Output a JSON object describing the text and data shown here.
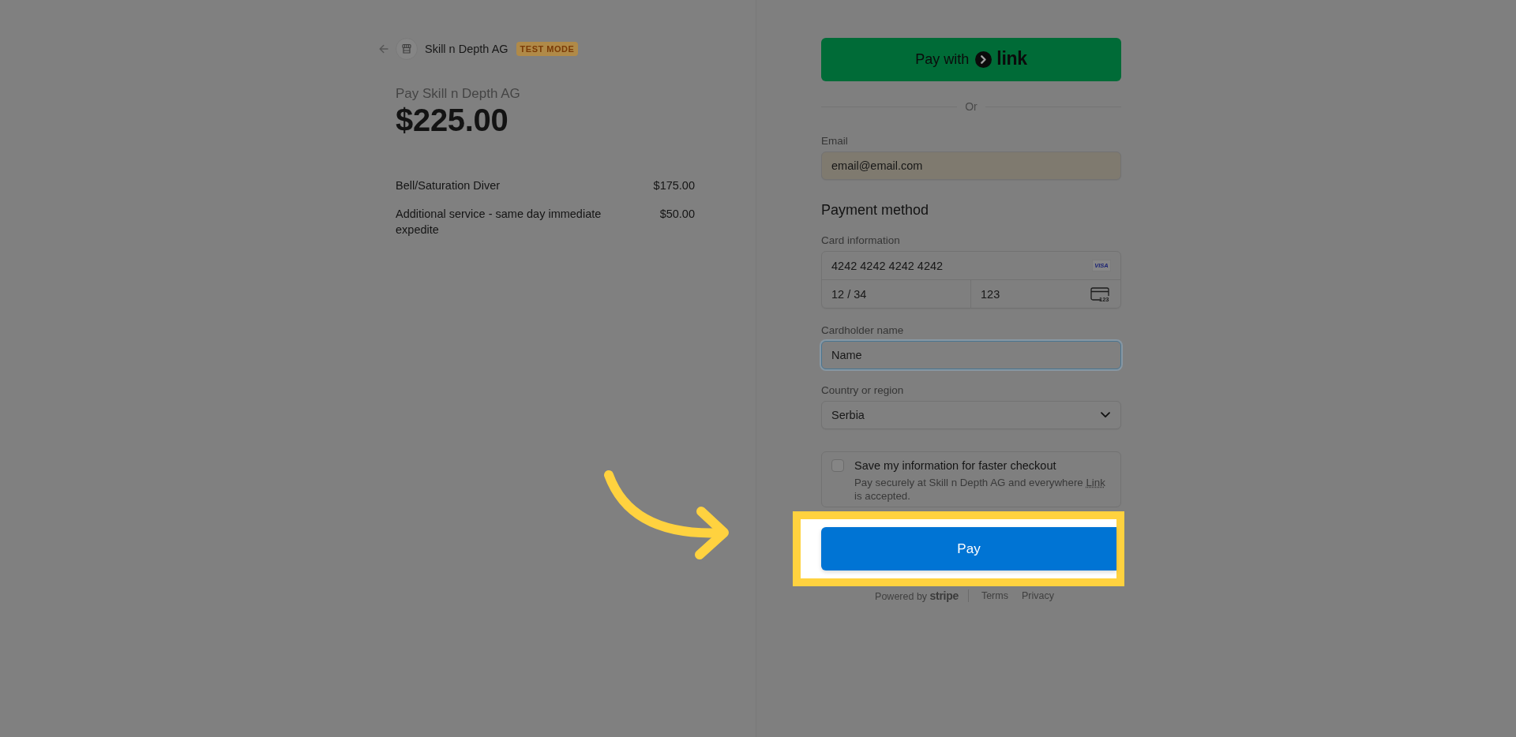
{
  "header": {
    "business_name": "Skill n Depth AG",
    "badge": "TEST MODE"
  },
  "summary": {
    "title": "Pay Skill n Depth AG",
    "amount": "$225.00"
  },
  "line_items": [
    {
      "name": "Bell/Saturation Diver",
      "price": "$175.00"
    },
    {
      "name": "Additional service - same day immediate expedite",
      "price": "$50.00"
    }
  ],
  "link_button": {
    "label": "Pay with",
    "brand": "link"
  },
  "separator": {
    "label": "Or"
  },
  "email": {
    "label": "Email",
    "value": "email@email.com",
    "autofilled": true
  },
  "payment_method": {
    "title": "Payment method",
    "card": {
      "label": "Card information",
      "number": "4242 4242 4242 4242",
      "brand_logo": "VISA",
      "expiry": "12 / 34",
      "cvc": "123",
      "cvc_icon_text": "123"
    },
    "cardholder": {
      "label": "Cardholder name",
      "value": "Name",
      "focused": true
    },
    "country": {
      "label": "Country or region",
      "value": "Serbia"
    }
  },
  "save_info": {
    "checked": false,
    "title": "Save my information for faster checkout",
    "description_before": "Pay securely at Skill n Depth AG and everywhere",
    "link": "Link",
    "description_after": "is accepted."
  },
  "pay_button": {
    "label": "Pay",
    "highlighted": true,
    "pointed_at": true
  },
  "footer": {
    "powered_by": "Powered by",
    "brand": "stripe",
    "links": [
      "Terms",
      "Privacy"
    ]
  }
}
